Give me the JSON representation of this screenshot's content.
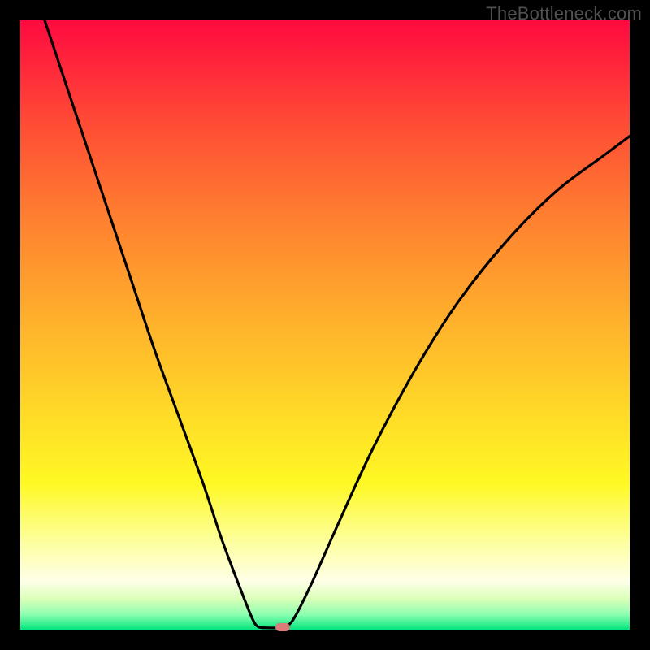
{
  "watermark": "TheBottleneck.com",
  "colors": {
    "frame": "#000000",
    "curve": "#000000",
    "marker": "#dd7b7b"
  },
  "chart_data": {
    "type": "line",
    "title": "",
    "xlabel": "",
    "ylabel": "",
    "xlim": [
      0,
      100
    ],
    "ylim": [
      0,
      100
    ],
    "grid": false,
    "legend": false,
    "curve": [
      {
        "x": 4,
        "y": 100
      },
      {
        "x": 6,
        "y": 94
      },
      {
        "x": 10,
        "y": 82
      },
      {
        "x": 14,
        "y": 70
      },
      {
        "x": 18,
        "y": 58
      },
      {
        "x": 22,
        "y": 46
      },
      {
        "x": 26,
        "y": 35
      },
      {
        "x": 30,
        "y": 24
      },
      {
        "x": 33,
        "y": 15
      },
      {
        "x": 36,
        "y": 7
      },
      {
        "x": 38,
        "y": 2
      },
      {
        "x": 39,
        "y": 0.5
      },
      {
        "x": 40.5,
        "y": 0.3
      },
      {
        "x": 42,
        "y": 0.3
      },
      {
        "x": 43.5,
        "y": 0.5
      },
      {
        "x": 45,
        "y": 2
      },
      {
        "x": 48,
        "y": 8
      },
      {
        "x": 52,
        "y": 17
      },
      {
        "x": 58,
        "y": 30
      },
      {
        "x": 65,
        "y": 43
      },
      {
        "x": 72,
        "y": 54
      },
      {
        "x": 80,
        "y": 64
      },
      {
        "x": 88,
        "y": 72
      },
      {
        "x": 96,
        "y": 78
      },
      {
        "x": 100,
        "y": 81
      }
    ],
    "marker": {
      "x": 43,
      "y": 0.4
    }
  }
}
